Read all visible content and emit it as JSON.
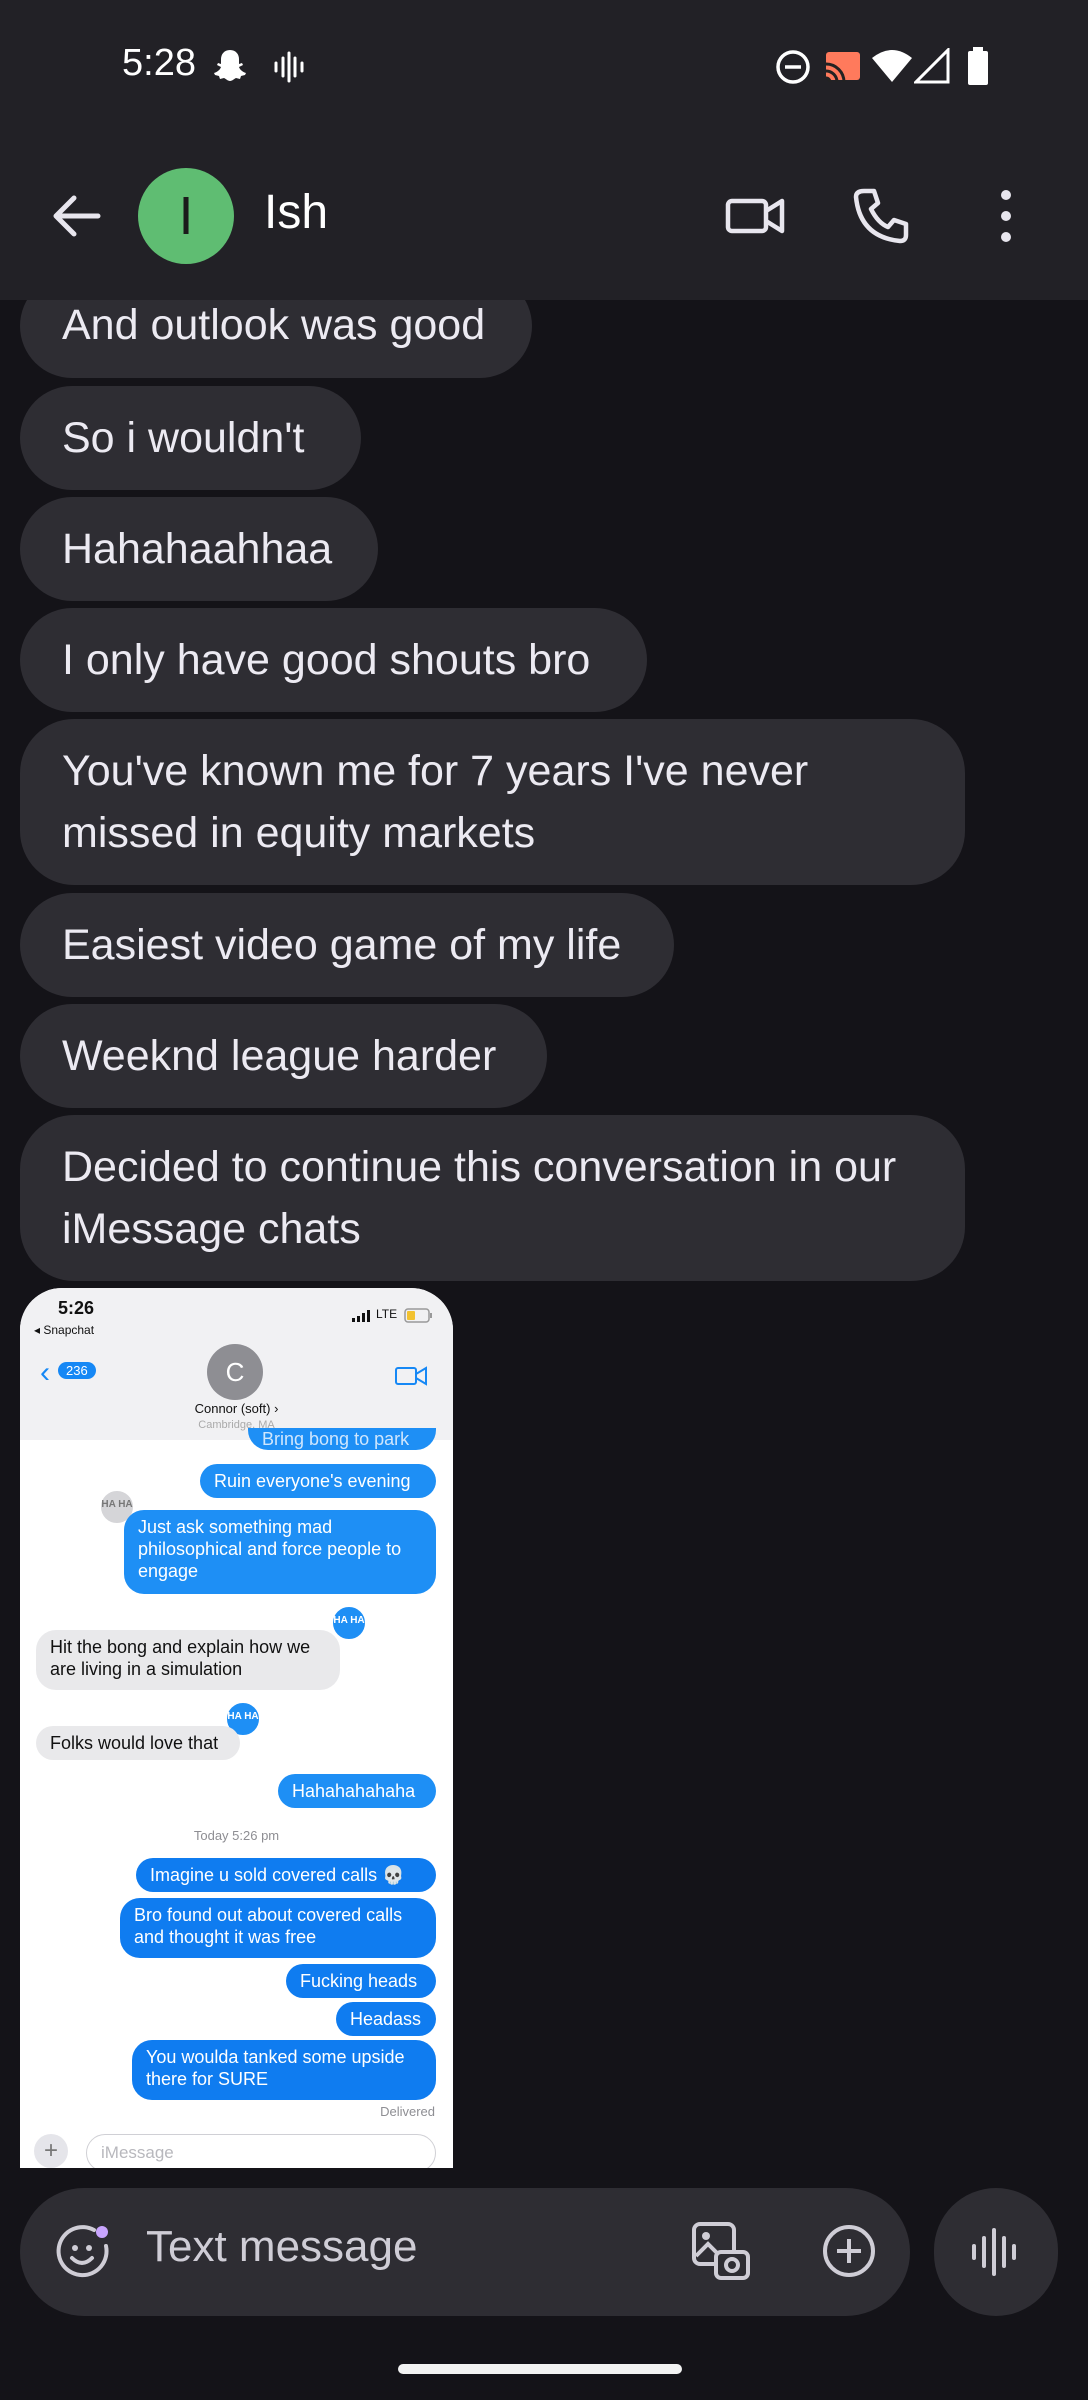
{
  "status_bar": {
    "time": "5:28"
  },
  "header": {
    "avatar_initial": "I",
    "contact_name": "Ish"
  },
  "messages": [
    "And outlook was good",
    "So i wouldn't",
    "Hahahaahhaa",
    "I only have good shouts bro",
    "You've known me for 7 years I've never missed in equity markets",
    "Easiest video game of my life",
    "Weeknd league harder",
    "Decided to continue this conversation in our iMessage chats"
  ],
  "screenshot": {
    "time": "5:26",
    "back_app": "◂ Snapchat",
    "network": "LTE",
    "back_count": "236",
    "avatar_initial": "C",
    "contact_name": "Connor (soft) ›",
    "contact_location": "Cambridge, MA",
    "tapback_label": "HA HA",
    "messages": [
      "Bring bong to park",
      "Ruin everyone's evening",
      "Just ask something mad philosophical and force people to engage",
      "Hit the bong and explain how we are living in a simulation",
      "Folks would love that",
      "Hahahahahaha",
      "Imagine u sold covered calls 💀",
      "Bro found out about covered calls and thought it was free",
      "Fucking heads",
      "Headass",
      "You woulda tanked some upside there for SURE"
    ],
    "timestamp": "Today 5:26 pm",
    "delivered": "Delivered",
    "input_placeholder": "iMessage"
  },
  "compose": {
    "placeholder": "Text message"
  }
}
